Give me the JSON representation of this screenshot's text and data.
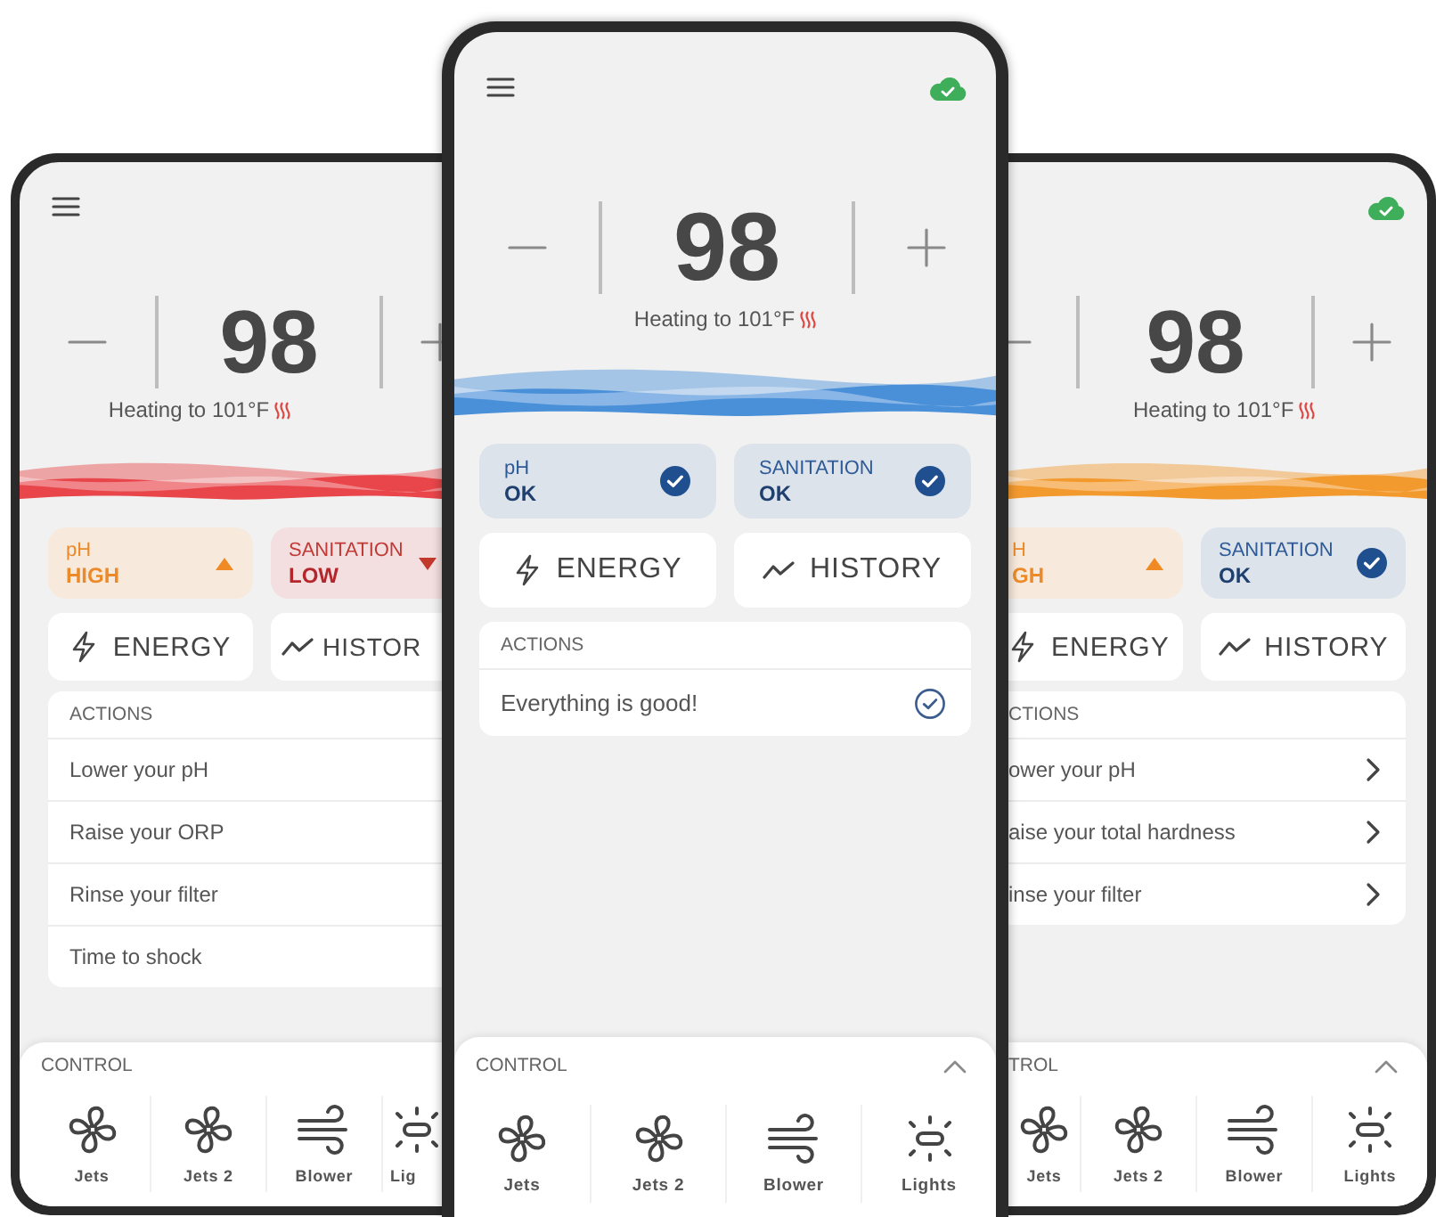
{
  "phones": [
    {
      "kind": "left",
      "menu": true,
      "synced": false,
      "color": "#e8464a",
      "setpoint": "98",
      "heating": "Heating to 101°F",
      "status": [
        {
          "label": "pH",
          "value": "HIGH",
          "kind": "high"
        },
        {
          "label": "SANITATION",
          "value": "LOW",
          "kind": "low"
        }
      ],
      "buttons": [
        {
          "label": "ENERGY",
          "kind": "energy"
        },
        {
          "label": "HISTOR",
          "kind": "history"
        }
      ],
      "actions": {
        "title": "ACTIONS",
        "rows": [
          {
            "text": "Lower your pH",
            "kind": "plain"
          },
          {
            "text": "Raise your ORP",
            "kind": "plain"
          },
          {
            "text": "Rinse your filter",
            "kind": "plain"
          },
          {
            "text": "Time to shock",
            "kind": "plain"
          }
        ]
      },
      "control": {
        "title": "CONTROL",
        "collapsible": false,
        "items": [
          {
            "label": "Jets",
            "kind": "fan"
          },
          {
            "label": "Jets 2",
            "kind": "fan"
          },
          {
            "label": "Blower",
            "kind": "wind"
          },
          {
            "label": "Lig",
            "kind": "light"
          }
        ]
      }
    },
    {
      "kind": "center",
      "menu": true,
      "synced": true,
      "color": "#4a90d9",
      "setpoint": "98",
      "heating": "Heating to 101°F",
      "status": [
        {
          "label": "pH",
          "value": "OK",
          "kind": "ok"
        },
        {
          "label": "SANITATION",
          "value": "OK",
          "kind": "ok"
        }
      ],
      "buttons": [
        {
          "label": "ENERGY",
          "kind": "energy"
        },
        {
          "label": "HISTORY",
          "kind": "history"
        }
      ],
      "actions": {
        "title": "ACTIONS",
        "rows": [
          {
            "text": "Everything is good!",
            "kind": "ok"
          }
        ]
      },
      "control": {
        "title": "CONTROL",
        "collapsible": true,
        "items": [
          {
            "label": "Jets",
            "kind": "fan"
          },
          {
            "label": "Jets 2",
            "kind": "fan"
          },
          {
            "label": "Blower",
            "kind": "wind"
          },
          {
            "label": "Lights",
            "kind": "light"
          }
        ]
      }
    },
    {
      "kind": "right",
      "menu": false,
      "synced": true,
      "color": "#f39a2e",
      "setpoint": "98",
      "heating": "Heating to 101°F",
      "status": [
        {
          "label": "H",
          "value": "GH",
          "kind": "high"
        },
        {
          "label": "SANITATION",
          "value": "OK",
          "kind": "ok"
        }
      ],
      "buttons": [
        {
          "label": "ENERGY",
          "kind": "energy"
        },
        {
          "label": "HISTORY",
          "kind": "history"
        }
      ],
      "actions": {
        "title": "CTIONS",
        "rows": [
          {
            "text": "ower your pH",
            "kind": "link"
          },
          {
            "text": "aise your total hardness",
            "kind": "link"
          },
          {
            "text": "inse your filter",
            "kind": "link"
          }
        ]
      },
      "control": {
        "title": "TROL",
        "collapsible": true,
        "items": [
          {
            "label": "Jets",
            "kind": "fan"
          },
          {
            "label": "Jets 2",
            "kind": "fan"
          },
          {
            "label": "Blower",
            "kind": "wind"
          },
          {
            "label": "Lights",
            "kind": "light"
          }
        ]
      }
    }
  ]
}
